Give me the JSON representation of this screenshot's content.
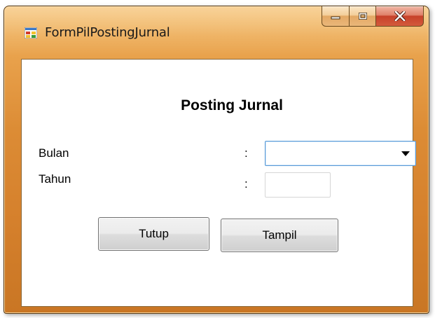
{
  "window": {
    "title": "FormPilPostingJurnal",
    "icon": "form-icon"
  },
  "caption_buttons": {
    "minimize_icon": "minimize-icon",
    "maximize_icon": "maximize-icon",
    "close_icon": "close-icon"
  },
  "form": {
    "heading": "Posting Jurnal",
    "bulan": {
      "label": "Bulan",
      "colon": ":",
      "value": ""
    },
    "tahun": {
      "label": "Tahun",
      "colon": ":",
      "value": ""
    },
    "buttons": {
      "tutup_label": "Tutup",
      "tampil_label": "Tampil"
    }
  },
  "colors": {
    "frame_accent": "#e8a04a",
    "close_button": "#c7412a",
    "focus_border": "#5a9bd8"
  }
}
